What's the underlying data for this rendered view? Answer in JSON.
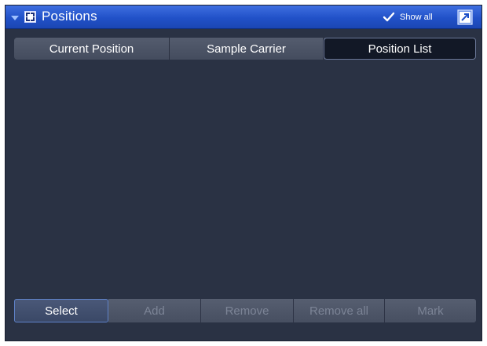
{
  "window": {
    "title": "Positions",
    "show_all_label": "Show all",
    "show_all_checked": true
  },
  "tabs": [
    {
      "label": "Current Position",
      "active": false
    },
    {
      "label": "Sample Carrier",
      "active": false
    },
    {
      "label": "Position List",
      "active": true
    }
  ],
  "buttons": [
    {
      "label": "Select",
      "enabled": true,
      "selected": true
    },
    {
      "label": "Add",
      "enabled": false
    },
    {
      "label": "Remove",
      "enabled": false
    },
    {
      "label": "Remove all",
      "enabled": false
    },
    {
      "label": "Mark",
      "enabled": false
    }
  ],
  "colors": {
    "titlebar": "#2151c8",
    "panel_bg": "#2a3244",
    "check": "#ffffff"
  },
  "icons": {
    "collapse": "collapse-triangle-icon",
    "module": "positions-module-icon",
    "check": "checkmark-icon",
    "undock": "undock-window-icon"
  }
}
